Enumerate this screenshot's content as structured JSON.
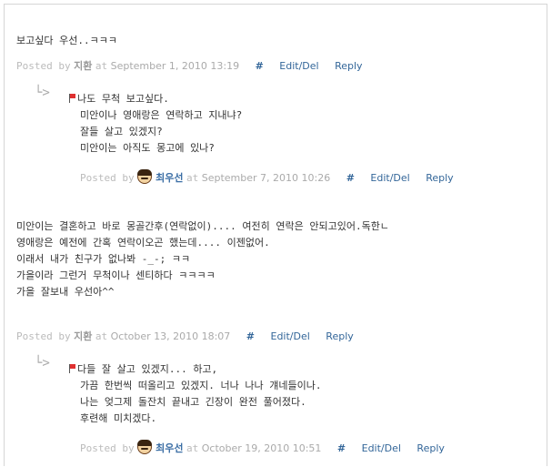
{
  "comments": [
    {
      "body": [
        "보고싶다 우선..ㅋㅋㅋ"
      ],
      "posted_prefix": "Posted by",
      "author": "지환",
      "at": "at",
      "date": "September 1, 2010 13:19",
      "hash": "#",
      "edit": "Edit/Del",
      "reply": "Reply",
      "reply_item": {
        "arrow": "└>",
        "body": [
          "나도 무척 보고싶다.",
          "미안이나 영애랑은 연락하고 지내냐?",
          "잘들 살고 있겠지?",
          "미안이는 아직도 몽고에 있나?"
        ],
        "posted_prefix": "Posted by",
        "author": "최우선",
        "at": "at",
        "date": "September 7, 2010 10:26",
        "hash": "#",
        "edit": "Edit/Del",
        "reply": "Reply"
      }
    },
    {
      "body": [
        "미안이는 결혼하고 바로 몽골간후(연락없이).... 여전히 연락은 안되고있어.독한ㄴ",
        "영애랑은 예전에 간혹 연락이오곤 했는데.... 이젠없어.",
        "이래서 내가 친구가 없나봐 -_-; ㅋㅋ",
        "",
        "가을이라 그런거 무척이나 센티하다 ㅋㅋㅋㅋ",
        "가을 잘보내 우선아^^"
      ],
      "posted_prefix": "Posted by",
      "author": "지환",
      "at": "at",
      "date": "October 13, 2010 18:07",
      "hash": "#",
      "edit": "Edit/Del",
      "reply": "Reply",
      "reply_item": {
        "arrow": "└>",
        "body": [
          "다들 잘 살고 있겠지... 하고,",
          "가끔 한번씩 떠올리고 있겠지. 너나 나나 걔네들이나.",
          "나는 엊그제 돌잔치 끝내고 긴장이 완전 풀어졌다.",
          "후련해 미치겠다."
        ],
        "posted_prefix": "Posted by",
        "author": "최우선",
        "at": "at",
        "date": "October 19, 2010 10:51",
        "hash": "#",
        "edit": "Edit/Del",
        "reply": "Reply"
      }
    }
  ]
}
